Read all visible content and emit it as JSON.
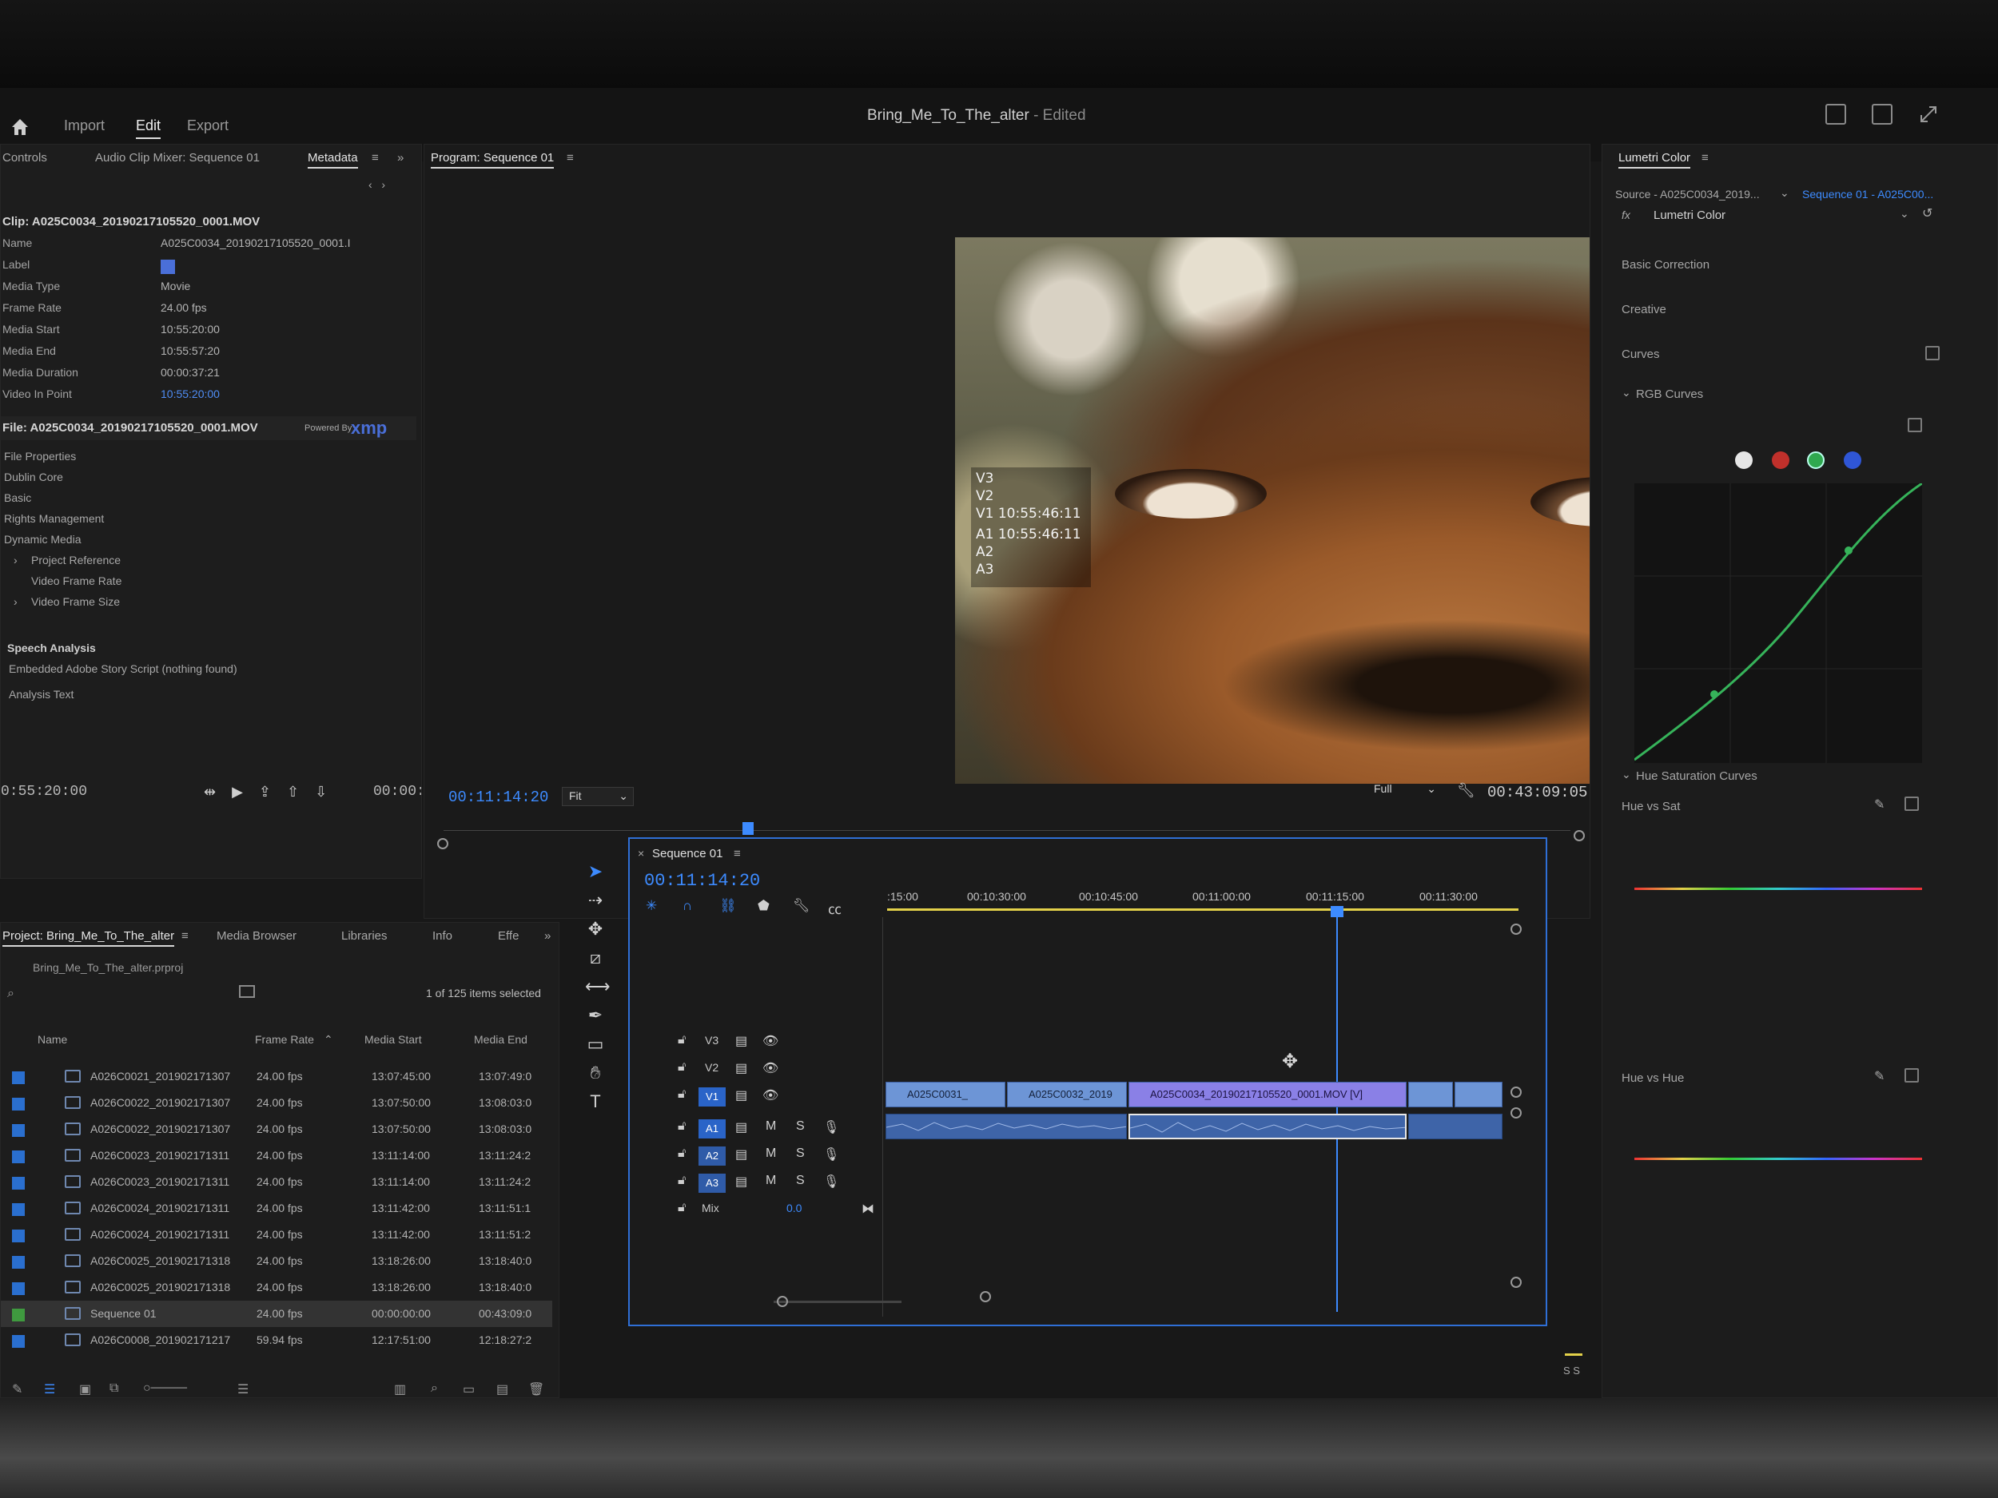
{
  "app": {
    "workspace_tabs": [
      "Import",
      "Edit",
      "Export"
    ],
    "active_workspace": "Edit",
    "doc_title": "Bring_Me_To_The_alter",
    "doc_status": "- Edited"
  },
  "source_panel": {
    "tabs": [
      "Controls",
      "Audio Clip Mixer: Sequence 01",
      "Metadata"
    ],
    "active_tab": "Metadata",
    "clip_header": "Clip: A025C0034_20190217105520_0001.MOV",
    "rows": [
      {
        "key": "Name",
        "value": "A025C0034_20190217105520_0001.I"
      },
      {
        "key": "Label",
        "value": ""
      },
      {
        "key": "Media Type",
        "value": "Movie"
      },
      {
        "key": "Frame Rate",
        "value": "24.00 fps"
      },
      {
        "key": "Media Start",
        "value": "10:55:20:00"
      },
      {
        "key": "Media End",
        "value": "10:55:57:20"
      },
      {
        "key": "Media Duration",
        "value": "00:00:37:21"
      },
      {
        "key": "Video In Point",
        "value": "10:55:20:00"
      }
    ],
    "file_header": "File: A025C0034_20190217105520_0001.MOV",
    "powered_by": "Powered By",
    "xmp_logo": "xmp",
    "file_sections": [
      "File Properties",
      "Dublin Core",
      "Basic",
      "Rights Management",
      "Dynamic Media"
    ],
    "file_subitems": [
      "Project Reference",
      "Video Frame Rate",
      "Video Frame Size"
    ],
    "speech_title": "Speech Analysis",
    "speech_note": "Embedded Adobe Story Script (nothing found)",
    "analysis_text": "Analysis Text",
    "timecode": "0:55:20:00",
    "timecode_right": "00:00:"
  },
  "program": {
    "title": "Program: Sequence 01",
    "overlay": [
      "V3",
      "V2",
      "V1 10:55:46:11",
      "A1 10:55:46:11",
      "A2",
      "A3"
    ],
    "current_time": "00:11:14:20",
    "fit": "Fit",
    "quality": "Full",
    "duration": "00:43:09:05",
    "playhead_fraction": 0.27
  },
  "project": {
    "tabs": [
      "Project: Bring_Me_To_The_alter",
      "Media Browser",
      "Libraries",
      "Info",
      "Effe"
    ],
    "active_tab": "Project: Bring_Me_To_The_alter",
    "file_name": "Bring_Me_To_The_alter.prproj",
    "selection": "1 of 125 items selected",
    "columns": [
      "Name",
      "Frame Rate",
      "Media Start",
      "Media End"
    ],
    "rows": [
      {
        "name": "A026C0021_201902171307",
        "fps": "24.00 fps",
        "start": "13:07:45:00",
        "end": "13:07:49:0",
        "color": "#2a6fcf"
      },
      {
        "name": "A026C0022_201902171307",
        "fps": "24.00 fps",
        "start": "13:07:50:00",
        "end": "13:08:03:0",
        "color": "#2a6fcf"
      },
      {
        "name": "A026C0022_201902171307",
        "fps": "24.00 fps",
        "start": "13:07:50:00",
        "end": "13:08:03:0",
        "color": "#2a6fcf"
      },
      {
        "name": "A026C0023_201902171311",
        "fps": "24.00 fps",
        "start": "13:11:14:00",
        "end": "13:11:24:2",
        "color": "#2a6fcf"
      },
      {
        "name": "A026C0023_201902171311",
        "fps": "24.00 fps",
        "start": "13:11:14:00",
        "end": "13:11:24:2",
        "color": "#2a6fcf"
      },
      {
        "name": "A026C0024_201902171311",
        "fps": "24.00 fps",
        "start": "13:11:42:00",
        "end": "13:11:51:1",
        "color": "#2a6fcf"
      },
      {
        "name": "A026C0024_201902171311",
        "fps": "24.00 fps",
        "start": "13:11:42:00",
        "end": "13:11:51:2",
        "color": "#2a6fcf"
      },
      {
        "name": "A026C0025_201902171318",
        "fps": "24.00 fps",
        "start": "13:18:26:00",
        "end": "13:18:40:0",
        "color": "#2a6fcf"
      },
      {
        "name": "A026C0025_201902171318",
        "fps": "24.00 fps",
        "start": "13:18:26:00",
        "end": "13:18:40:0",
        "color": "#2a6fcf"
      },
      {
        "name": "Sequence 01",
        "fps": "24.00 fps",
        "start": "00:00:00:00",
        "end": "00:43:09:0",
        "color": "#3f9a3f",
        "selected": true
      },
      {
        "name": "A026C0008_201902171217",
        "fps": "59.94 fps",
        "start": "12:17:51:00",
        "end": "12:18:27:2",
        "color": "#2a6fcf"
      }
    ]
  },
  "timeline": {
    "tab": "Sequence 01",
    "current_time": "00:11:14:20",
    "ruler": [
      ":15:00",
      "00:10:30:00",
      "00:10:45:00",
      "00:11:00:00",
      "00:11:15:00",
      "00:11:30:00"
    ],
    "video_tracks": [
      "V3",
      "V2",
      "V1"
    ],
    "audio_tracks": [
      "A1",
      "A2",
      "A3"
    ],
    "mix_label": "Mix",
    "mix_value": "0.0",
    "clips": [
      "A025C0031_",
      "A025C0032_2019",
      "A025C0034_20190217105520_0001.MOV [V]"
    ]
  },
  "lumetri": {
    "title": "Lumetri Color",
    "source": "Source - A025C0034_2019...",
    "sequence": "Sequence 01 - A025C00...",
    "effect": "Lumetri Color",
    "sections": [
      "Basic Correction",
      "Creative",
      "Curves"
    ],
    "rgb_curves": "RGB Curves",
    "hue_sat_curves": "Hue Saturation Curves",
    "hue_vs_sat": "Hue vs Sat",
    "hue_vs_hue": "Hue vs Hue",
    "channel_colors": [
      "#e6e6e6",
      "#c0302b",
      "#2fa84f",
      "#2f56d6"
    ]
  },
  "audio_meter": {
    "label": "S S"
  }
}
